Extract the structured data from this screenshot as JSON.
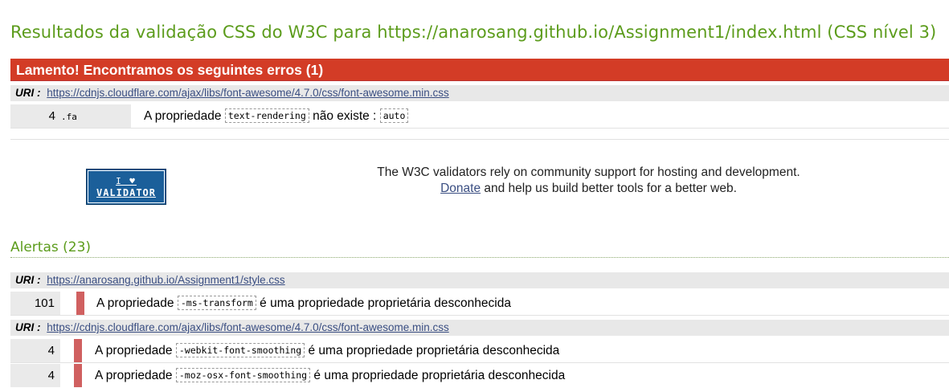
{
  "page": {
    "title": "Resultados da validação CSS do W3C para https://anarosang.github.io/Assignment1/index.html (CSS nível 3)"
  },
  "errors": {
    "heading": "Lamento! Encontramos os seguintes erros (1)",
    "uri_label": "URI :",
    "uri": "https://cdnjs.cloudflare.com/ajax/libs/font-awesome/4.7.0/css/font-awesome.min.css",
    "items": [
      {
        "line": "4",
        "context": ".fa",
        "msg_prefix": "A propriedade",
        "property": "text-rendering",
        "msg_middle": "não existe :",
        "value": "auto"
      }
    ]
  },
  "banner": {
    "badge_line1": "I ♥",
    "badge_line2": "VALIDATOR",
    "support_text": "The W3C validators rely on community support for hosting and development.",
    "donate_link": "Donate",
    "donate_suffix": "and help us build better tools for a better web."
  },
  "warnings": {
    "heading": "Alertas (23)",
    "groups": [
      {
        "uri_label": "URI :",
        "uri": "https://anarosang.github.io/Assignment1/style.css",
        "items": [
          {
            "line": "101",
            "msg_prefix": "A propriedade",
            "property": "-ms-transform",
            "msg_suffix": "é uma propriedade proprietária desconhecida"
          }
        ]
      },
      {
        "uri_label": "URI :",
        "uri": "https://cdnjs.cloudflare.com/ajax/libs/font-awesome/4.7.0/css/font-awesome.min.css",
        "items": [
          {
            "line": "4",
            "msg_prefix": "A propriedade",
            "property": "-webkit-font-smoothing",
            "msg_suffix": "é uma propriedade proprietária desconhecida"
          },
          {
            "line": "4",
            "msg_prefix": "A propriedade",
            "property": "-moz-osx-font-smoothing",
            "msg_suffix": "é uma propriedade proprietária desconhecida"
          }
        ]
      }
    ]
  },
  "colors": {
    "title_green": "#5c9c1c",
    "error_red": "#d33c26",
    "warning_bar": "#d06060",
    "link_blue": "#3a4e82"
  }
}
